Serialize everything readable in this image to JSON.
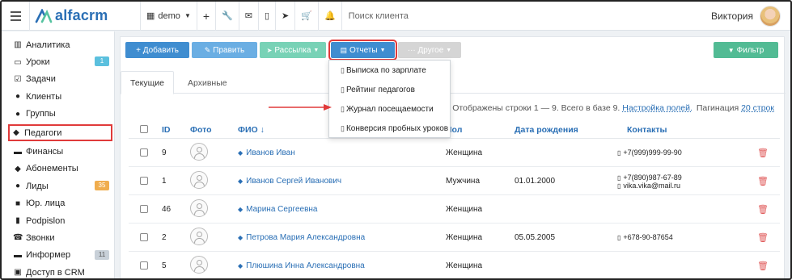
{
  "topbar": {
    "brand": "alfacrm",
    "branch": "demo",
    "search_placeholder": "Поиск клиента",
    "user_name": "Виктория"
  },
  "sidebar": {
    "items": [
      {
        "label": "Аналитика",
        "icon": "book-icon"
      },
      {
        "label": "Уроки",
        "icon": "calendar-icon",
        "badge": "1",
        "badge_color": "#5bc0de"
      },
      {
        "label": "Задачи",
        "icon": "tasks-icon"
      },
      {
        "label": "Клиенты",
        "icon": "user-icon"
      },
      {
        "label": "Группы",
        "icon": "users-icon"
      },
      {
        "label": "Педагоги",
        "icon": "graduation-cap-icon"
      },
      {
        "label": "Финансы",
        "icon": "money-icon"
      },
      {
        "label": "Абонементы",
        "icon": "tag-icon"
      },
      {
        "label": "Лиды",
        "icon": "user-plus-icon",
        "badge": "35",
        "badge_color": "#f0ad4e"
      },
      {
        "label": "Юр. лица",
        "icon": "briefcase-icon"
      },
      {
        "label": "Podpislon",
        "icon": "file-icon"
      },
      {
        "label": "Звонки",
        "icon": "phone-icon"
      },
      {
        "label": "Информер",
        "icon": "inbox-icon",
        "badge": "11",
        "badge_color": "#c8d0d8"
      },
      {
        "label": "Доступ в CRM",
        "icon": "lock-icon"
      }
    ]
  },
  "toolbar": {
    "add": "+ Добавить",
    "edit": "Править",
    "mailing": "Рассылка",
    "reports": "Отчеты",
    "other": "··· Другое",
    "filter": "Фильтр"
  },
  "tabs": [
    "Текущие",
    "Архивные"
  ],
  "reports_menu": [
    "Выписка по зарплате",
    "Рейтинг педагогов",
    "Журнал посещаемости",
    "Конверсия пробных уроков"
  ],
  "table_info": {
    "text": "Отображены строки 1 — 9. Всего в базе 9.",
    "fields_link": "Настройка полей.",
    "pagination_label": "Пагинация",
    "pagination_link": "20 строк"
  },
  "table": {
    "headers": {
      "id": "ID",
      "photo": "Фото",
      "name": "ФИО ↓",
      "gender": "Пол",
      "birthday": "Дата рождения",
      "contacts": "Контакты"
    },
    "rows": [
      {
        "id": "9",
        "name": "Иванов Иван",
        "gender": "Женщина",
        "birthday": "",
        "contacts": [
          "+7(999)999-99-90"
        ]
      },
      {
        "id": "1",
        "name": "Иванов Сергей Иванович",
        "gender": "Мужчина",
        "birthday": "01.01.2000",
        "contacts": [
          "+7(890)987-67-89",
          "vika.vika@mail.ru"
        ]
      },
      {
        "id": "46",
        "name": "Марина Сергеевна",
        "gender": "Женщина",
        "birthday": "",
        "contacts": []
      },
      {
        "id": "2",
        "name": "Петрова Мария Александровна",
        "gender": "Женщина",
        "birthday": "05.05.2005",
        "contacts": [
          "+678-90-87654"
        ]
      },
      {
        "id": "5",
        "name": "Плюшина Инна Александровна",
        "gender": "Женщина",
        "birthday": "",
        "contacts": []
      }
    ]
  },
  "colors": {
    "accent": "#2a6fb5",
    "highlight_border": "#e03a3a",
    "filter_button": "#52bb94"
  }
}
